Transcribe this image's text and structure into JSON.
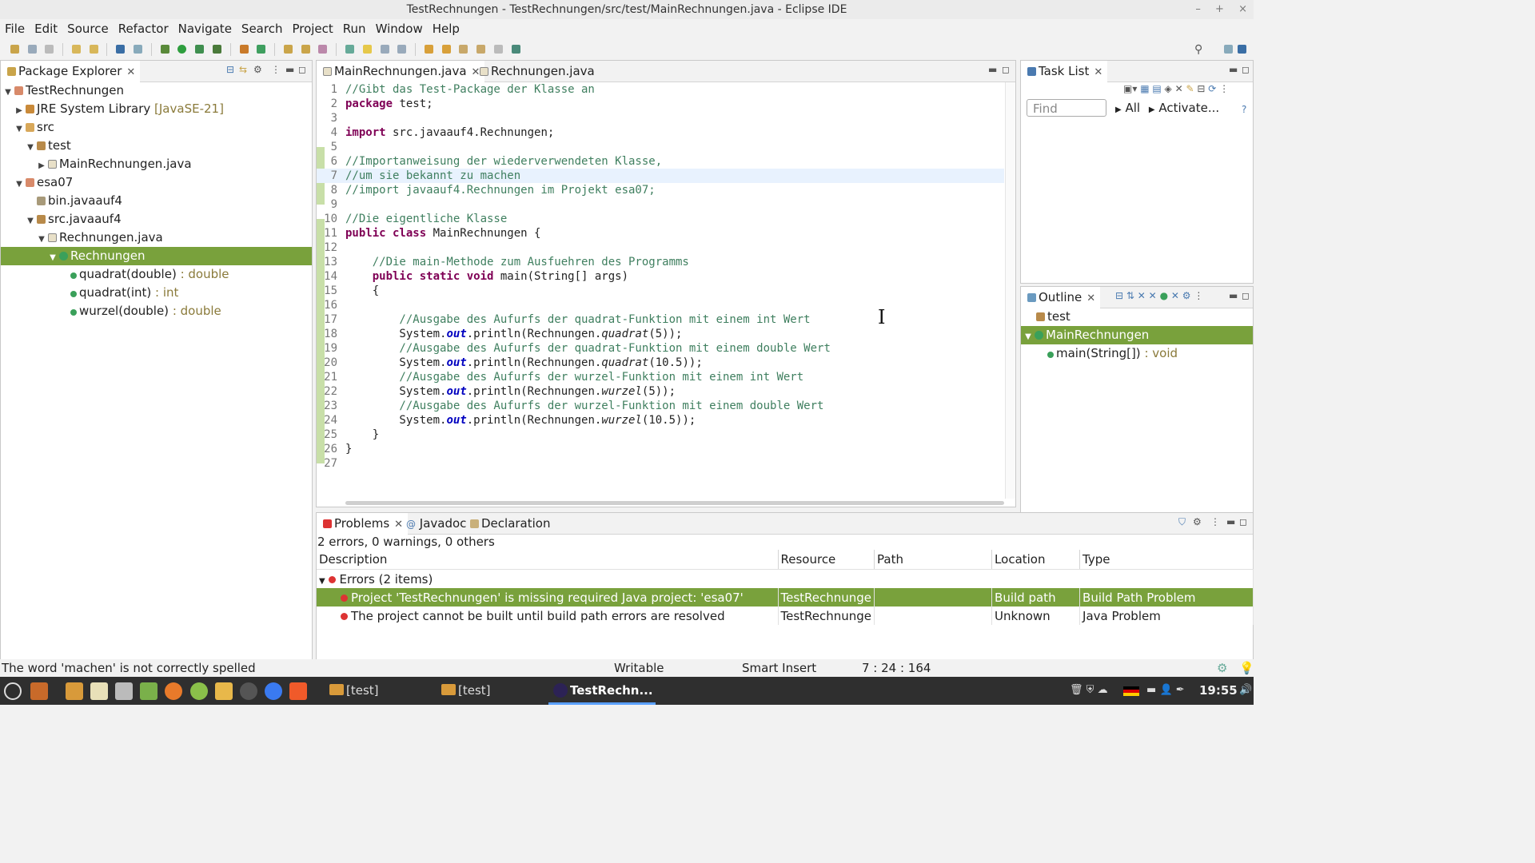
{
  "window": {
    "title": "TestRechnungen - TestRechnungen/src/test/MainRechnungen.java - Eclipse IDE",
    "min": "–",
    "max": "+",
    "close": "×"
  },
  "menu": [
    "File",
    "Edit",
    "Source",
    "Refactor",
    "Navigate",
    "Search",
    "Project",
    "Run",
    "Window",
    "Help"
  ],
  "package_explorer": {
    "tab": "Package Explorer",
    "rows": [
      {
        "label": "TestRechnungen",
        "extra": ""
      },
      {
        "label": "JRE System Library",
        "extra": "[JavaSE-21]"
      },
      {
        "label": "src",
        "extra": ""
      },
      {
        "label": "test",
        "extra": ""
      },
      {
        "label": "MainRechnungen.java",
        "extra": ""
      },
      {
        "label": "esa07",
        "extra": ""
      },
      {
        "label": "bin.javaauf4",
        "extra": ""
      },
      {
        "label": "src.javaauf4",
        "extra": ""
      },
      {
        "label": "Rechnungen.java",
        "extra": ""
      },
      {
        "label": "Rechnungen",
        "extra": ""
      },
      {
        "label": "quadrat(double)",
        "extra": ": double"
      },
      {
        "label": "quadrat(int)",
        "extra": ": int"
      },
      {
        "label": "wurzel(double)",
        "extra": ": double"
      }
    ]
  },
  "editor": {
    "tabs": [
      "MainRechnungen.java",
      "Rechnungen.java"
    ],
    "lines": [
      "1",
      "2",
      "3",
      "4",
      "5",
      "6",
      "7",
      "8",
      "9",
      "10",
      "11",
      "12",
      "13",
      "14",
      "15",
      "16",
      "17",
      "18",
      "19",
      "20",
      "21",
      "22",
      "23",
      "24",
      "25",
      "26",
      "27"
    ],
    "code": {
      "l1": "//Gibt das Test-Package der Klasse an",
      "l2a": "package",
      "l2b": " test;",
      "l4a": "import",
      "l4b": " src.javaauf4.Rechnungen;",
      "l6": "//Importanweisung der wiederverwendeten Klasse,",
      "l7": "//um sie bekannt zu machen",
      "l8": "//import javaauf4.Rechnungen im Projekt esa07;",
      "l10": "//Die eigentliche Klasse",
      "l11a": "public class",
      "l11b": " MainRechnungen {",
      "l13": "    //Die main-Methode zum Ausfuehren des Programms",
      "l14a": "    public static void",
      "l14b": " main(String[] args)",
      "l15": "    {",
      "l17": "        //Ausgabe des Aufurfs der quadrat-Funktion mit einem int Wert",
      "l18a": "        System.",
      "l18b": "out",
      "l18c": ".println(Rechnungen.",
      "l18d": "quadrat",
      "l18e": "(5));",
      "l19": "        //Ausgabe des Aufurfs der quadrat-Funktion mit einem double Wert",
      "l20a": "        System.",
      "l20b": "out",
      "l20c": ".println(Rechnungen.",
      "l20d": "quadrat",
      "l20e": "(10.5));",
      "l21": "        //Ausgabe des Aufurfs der wurzel-Funktion mit einem int Wert",
      "l22a": "        System.",
      "l22b": "out",
      "l22c": ".println(Rechnungen.",
      "l22d": "wurzel",
      "l22e": "(5));",
      "l23": "        //Ausgabe des Aufurfs der wurzel-Funktion mit einem double Wert",
      "l24a": "        System.",
      "l24b": "out",
      "l24c": ".println(Rechnungen.",
      "l24d": "wurzel",
      "l24e": "(10.5));",
      "l25": "    }",
      "l26": "}"
    }
  },
  "task_list": {
    "tab": "Task List",
    "find_placeholder": "Find",
    "all": "All",
    "activate": "Activate..."
  },
  "outline": {
    "tab": "Outline",
    "rows": [
      {
        "label": "test",
        "extra": ""
      },
      {
        "label": "MainRechnungen",
        "extra": ""
      },
      {
        "label": "main(String[])",
        "extra": ": void"
      }
    ]
  },
  "problems": {
    "tabs": [
      "Problems",
      "Javadoc",
      "Declaration"
    ],
    "summary": "2 errors, 0 warnings, 0 others",
    "columns": [
      "Description",
      "Resource",
      "Path",
      "Location",
      "Type"
    ],
    "group": "Errors (2 items)",
    "rows": [
      {
        "description": "Project 'TestRechnungen' is missing required Java project: 'esa07'",
        "resource": "TestRechnunge",
        "path": "",
        "location": "Build path",
        "type": "Build Path Problem"
      },
      {
        "description": "The project cannot be built until build path errors are resolved",
        "resource": "TestRechnunge",
        "path": "",
        "location": "Unknown",
        "type": "Java Problem"
      }
    ]
  },
  "status": {
    "message": "The word 'machen' is not correctly spelled",
    "writable": "Writable",
    "insert": "Smart Insert",
    "position": "7 : 24 : 164"
  },
  "taskbar": {
    "tasks": [
      "[test]",
      "[test]",
      "TestRechn..."
    ],
    "clock": "19:55"
  }
}
